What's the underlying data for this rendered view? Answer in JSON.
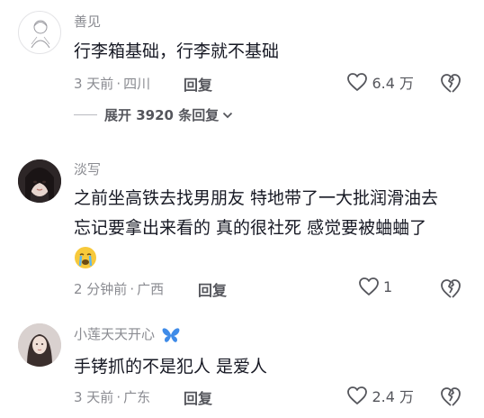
{
  "comments": [
    {
      "username": "善见",
      "text": "行李箱基础，行李就不基础",
      "time": "3 天前",
      "location": "四川",
      "reply_label": "回复",
      "likes": "6.4 万",
      "avatar_icon": "sketch-avatar"
    },
    {
      "username": "淡写",
      "text_line1": "之前坐高铁去找男朋友 特地带了一大批润滑油去",
      "text_line2": "忘记要拿出来看的 真的很社死 感觉要被蛐蛐了",
      "emoji_icon": "crying-face-emoji",
      "time": "2 分钟前",
      "location": "广西",
      "reply_label": "回复",
      "likes": "1",
      "avatar_icon": "photo-avatar"
    },
    {
      "username": "小莲天天开心",
      "username_badge_icon": "butterfly-icon",
      "text": "手铐抓的不是犯人 是爱人",
      "time": "3 天前",
      "location": "广东",
      "reply_label": "回复",
      "likes": "2.4 万",
      "avatar_icon": "photo-avatar"
    }
  ],
  "expand_replies": {
    "label": "展开 3920 条回复"
  },
  "colors": {
    "text": "#161823",
    "secondary": "#8a8b91",
    "action": "#55565c",
    "butterfly": "#3f8be8",
    "emoji": "#f7c93b"
  }
}
